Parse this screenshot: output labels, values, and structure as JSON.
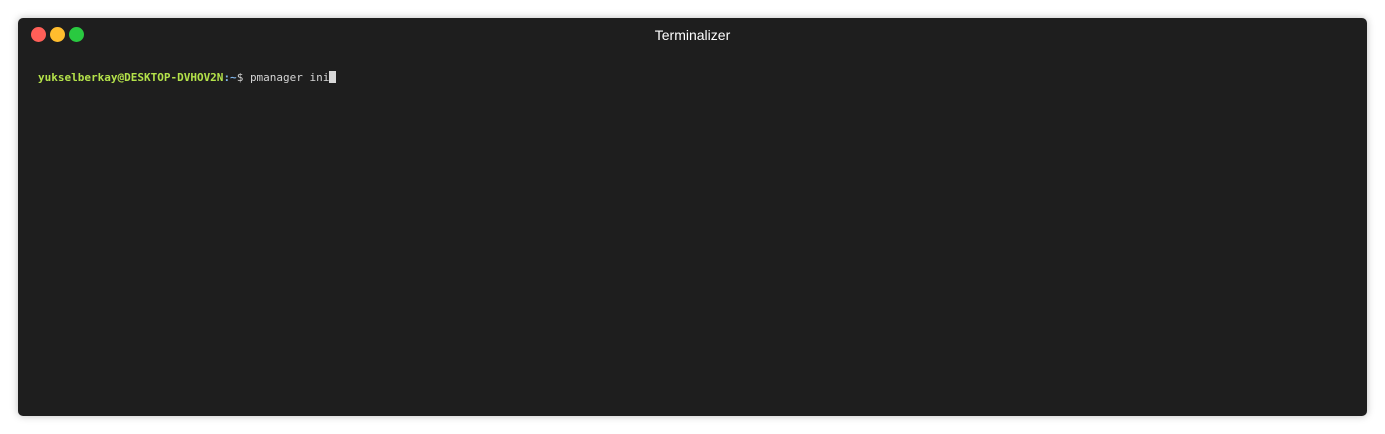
{
  "window": {
    "title": "Terminalizer",
    "controls": [
      {
        "name": "close",
        "color": "#ff5f58"
      },
      {
        "name": "minimize",
        "color": "#ffbd2e"
      },
      {
        "name": "maximize",
        "color": "#29c940"
      }
    ]
  },
  "terminal": {
    "user_host": "yukselberkay@DESKTOP-DVHOV2N",
    "path": ":~",
    "prompt_symbol": "$",
    "command": "pmanager ini"
  }
}
